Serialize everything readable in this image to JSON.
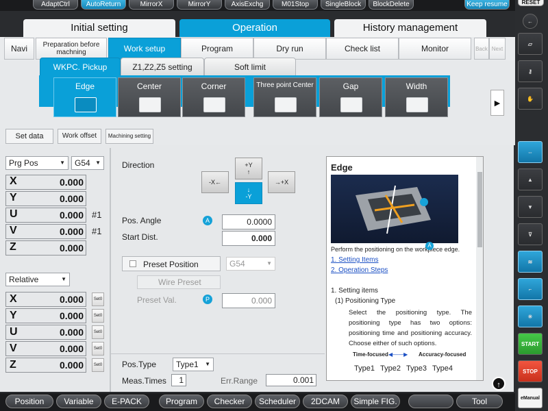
{
  "top_buttons": [
    "AdaptCtrl",
    "AutoReturn",
    "MirrorX",
    "MirrorY",
    "AxisExchg",
    "M01Stop",
    "SingleBlock",
    "BlockDelete",
    "Keep resume"
  ],
  "reset": "RESET",
  "main_tabs": [
    "Initial setting",
    "Operation",
    "History management"
  ],
  "nav_tabs": [
    "Navi",
    "Preparation before machning",
    "Work setup",
    "Program",
    "Dry run",
    "Check list",
    "Monitor",
    "Back",
    "Next"
  ],
  "pickup_tabs": [
    "WKPC. Pickup",
    "Z1,Z2,Z5 setting",
    "Soft limit"
  ],
  "sub_tabs": [
    "Edge",
    "Center",
    "Corner",
    "Three point Center",
    "Gap",
    "Width"
  ],
  "toolbar": [
    "Set data",
    "Work offset",
    "Machining setting"
  ],
  "prg_pos": {
    "select": "Prg Pos",
    "coord": "G54",
    "axes": [
      {
        "name": "X",
        "value": "0.000",
        "note": ""
      },
      {
        "name": "Y",
        "value": "0.000",
        "note": ""
      },
      {
        "name": "U",
        "value": "0.000",
        "note": "#1"
      },
      {
        "name": "V",
        "value": "0.000",
        "note": "#1"
      },
      {
        "name": "Z",
        "value": "0.000",
        "note": ""
      }
    ]
  },
  "relative": {
    "select": "Relative",
    "axes": [
      {
        "name": "X",
        "value": "0.000"
      },
      {
        "name": "Y",
        "value": "0.000"
      },
      {
        "name": "U",
        "value": "0.000"
      },
      {
        "name": "V",
        "value": "0.000"
      },
      {
        "name": "Z",
        "value": "0.000"
      }
    ],
    "set0": "Set0"
  },
  "direction": {
    "label": "Direction",
    "minus_x": "-X",
    "plus_y": "+Y",
    "minus_y": "-Y",
    "plus_x": "+X"
  },
  "pos_angle": {
    "label": "Pos. Angle",
    "badge": "A",
    "value": "0.0000"
  },
  "start_dist": {
    "label": "Start Dist.",
    "value": "0.000"
  },
  "preset": {
    "label": "Preset Position",
    "coord": "G54",
    "wire": "Wire Preset",
    "val_label": "Preset Val.",
    "badge": "P",
    "value": "0.000"
  },
  "pos_type": {
    "label": "Pos.Type",
    "value": "Type1"
  },
  "meas": {
    "label": "Meas.Times",
    "value": "1",
    "err_label": "Err.Range",
    "err_value": "0.001"
  },
  "help": {
    "title": "Edge",
    "desc": "Perform the positioning on the workpiece edge.",
    "link1": "1. Setting Items",
    "link2": "2. Operation Steps",
    "sec": "1. Setting items",
    "sub": "(1) Positioning Type",
    "body": "Select the positioning type. The positioning type has two options: positioning time and positioning accuracy. Choose either of such options.",
    "left_arrow": "Time-focused",
    "right_arrow": "Accuracy-focused",
    "types": [
      "Type1",
      "Type2",
      "Type3",
      "Type4"
    ],
    "badge": "A"
  },
  "side": {
    "start": "START",
    "stop": "STOP",
    "emanual": "eManual"
  },
  "bottom": [
    "Position",
    "Variable",
    "E-PACK",
    "Program",
    "Checker",
    "Scheduler",
    "2DCAM",
    "Simple FIG.",
    "",
    "Tool"
  ]
}
